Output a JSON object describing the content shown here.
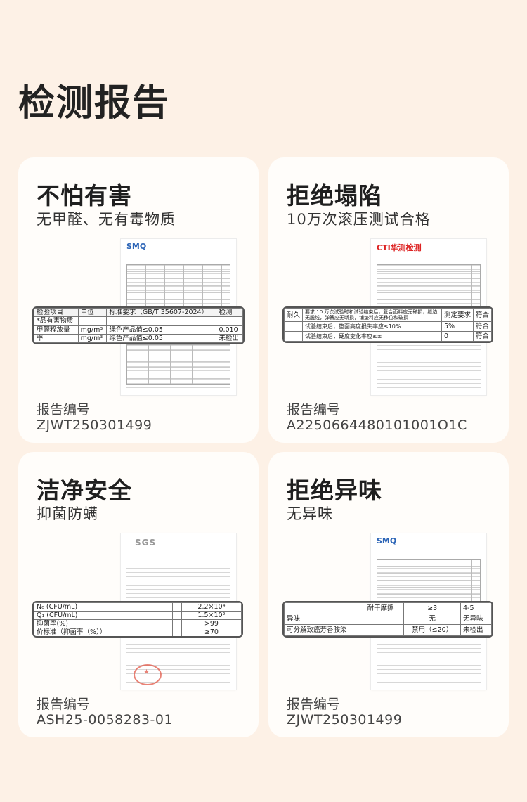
{
  "page": {
    "title": "检测报告"
  },
  "cards": [
    {
      "title": "不怕有害",
      "subtitle": "无甲醛、无有毒物质",
      "report_label": "报告编号",
      "report_number": "ZJWT250301499",
      "doc_logo": "SMQ",
      "zoom": {
        "header": [
          "检验项目",
          "单位",
          "标准要求（GB/T 35607-2024）",
          "检测"
        ],
        "rows": [
          [
            "*品有害物质",
            "",
            "",
            ""
          ],
          [
            "甲醛释放量",
            "mg/m³",
            "绿色产品值≤0.05",
            "0.010"
          ],
          [
            "率",
            "mg/m³",
            "绿色产品值≤0.05",
            "未检出"
          ]
        ]
      }
    },
    {
      "title": "拒绝塌陷",
      "subtitle": "10万次滚压测试合格",
      "report_label": "报告编号",
      "report_number": "A2250664480101001O1C",
      "doc_logo": "CTI华测检测",
      "zoom": {
        "rows": [
          [
            "耐久",
            "要求 10 万次试验时和试验结束后，复合面料应无破损，缝边无脱线，弹簧应无断损，铺垫料应无移位和破损",
            "测定要求",
            "符合"
          ],
          [
            "",
            "试验结束后，垫面高度损失率应≤10%",
            "5%",
            "符合"
          ],
          [
            "",
            "试验结束后，硬度变化率应≤±",
            "0",
            "符合"
          ]
        ]
      }
    },
    {
      "title": "洁净安全",
      "subtitle": "抑菌防螨",
      "report_label": "报告编号",
      "report_number": "ASH25-0058283-01",
      "doc_logo": "SGS",
      "zoom": {
        "rows": [
          [
            "N₀ (CFU/mL)",
            "",
            "2.2×10⁴"
          ],
          [
            "Q₁ (CFU/mL)",
            "",
            "1.5×10²"
          ],
          [
            "抑菌率(%)",
            "",
            ">99"
          ],
          [
            "价标准（抑菌率（%））",
            "",
            "≥70"
          ]
        ]
      }
    },
    {
      "title": "拒绝异味",
      "subtitle": "无异味",
      "report_label": "报告编号",
      "report_number": "ZJWT250301499",
      "doc_logo": "SMQ",
      "zoom": {
        "rows": [
          [
            "",
            "耐干摩擦",
            "≥3",
            "4-5"
          ],
          [
            "异味",
            "",
            "无",
            "无异味"
          ],
          [
            "可分解致癌芳香胺染",
            "",
            "禁用（≤20）",
            "未检出"
          ]
        ]
      }
    }
  ]
}
